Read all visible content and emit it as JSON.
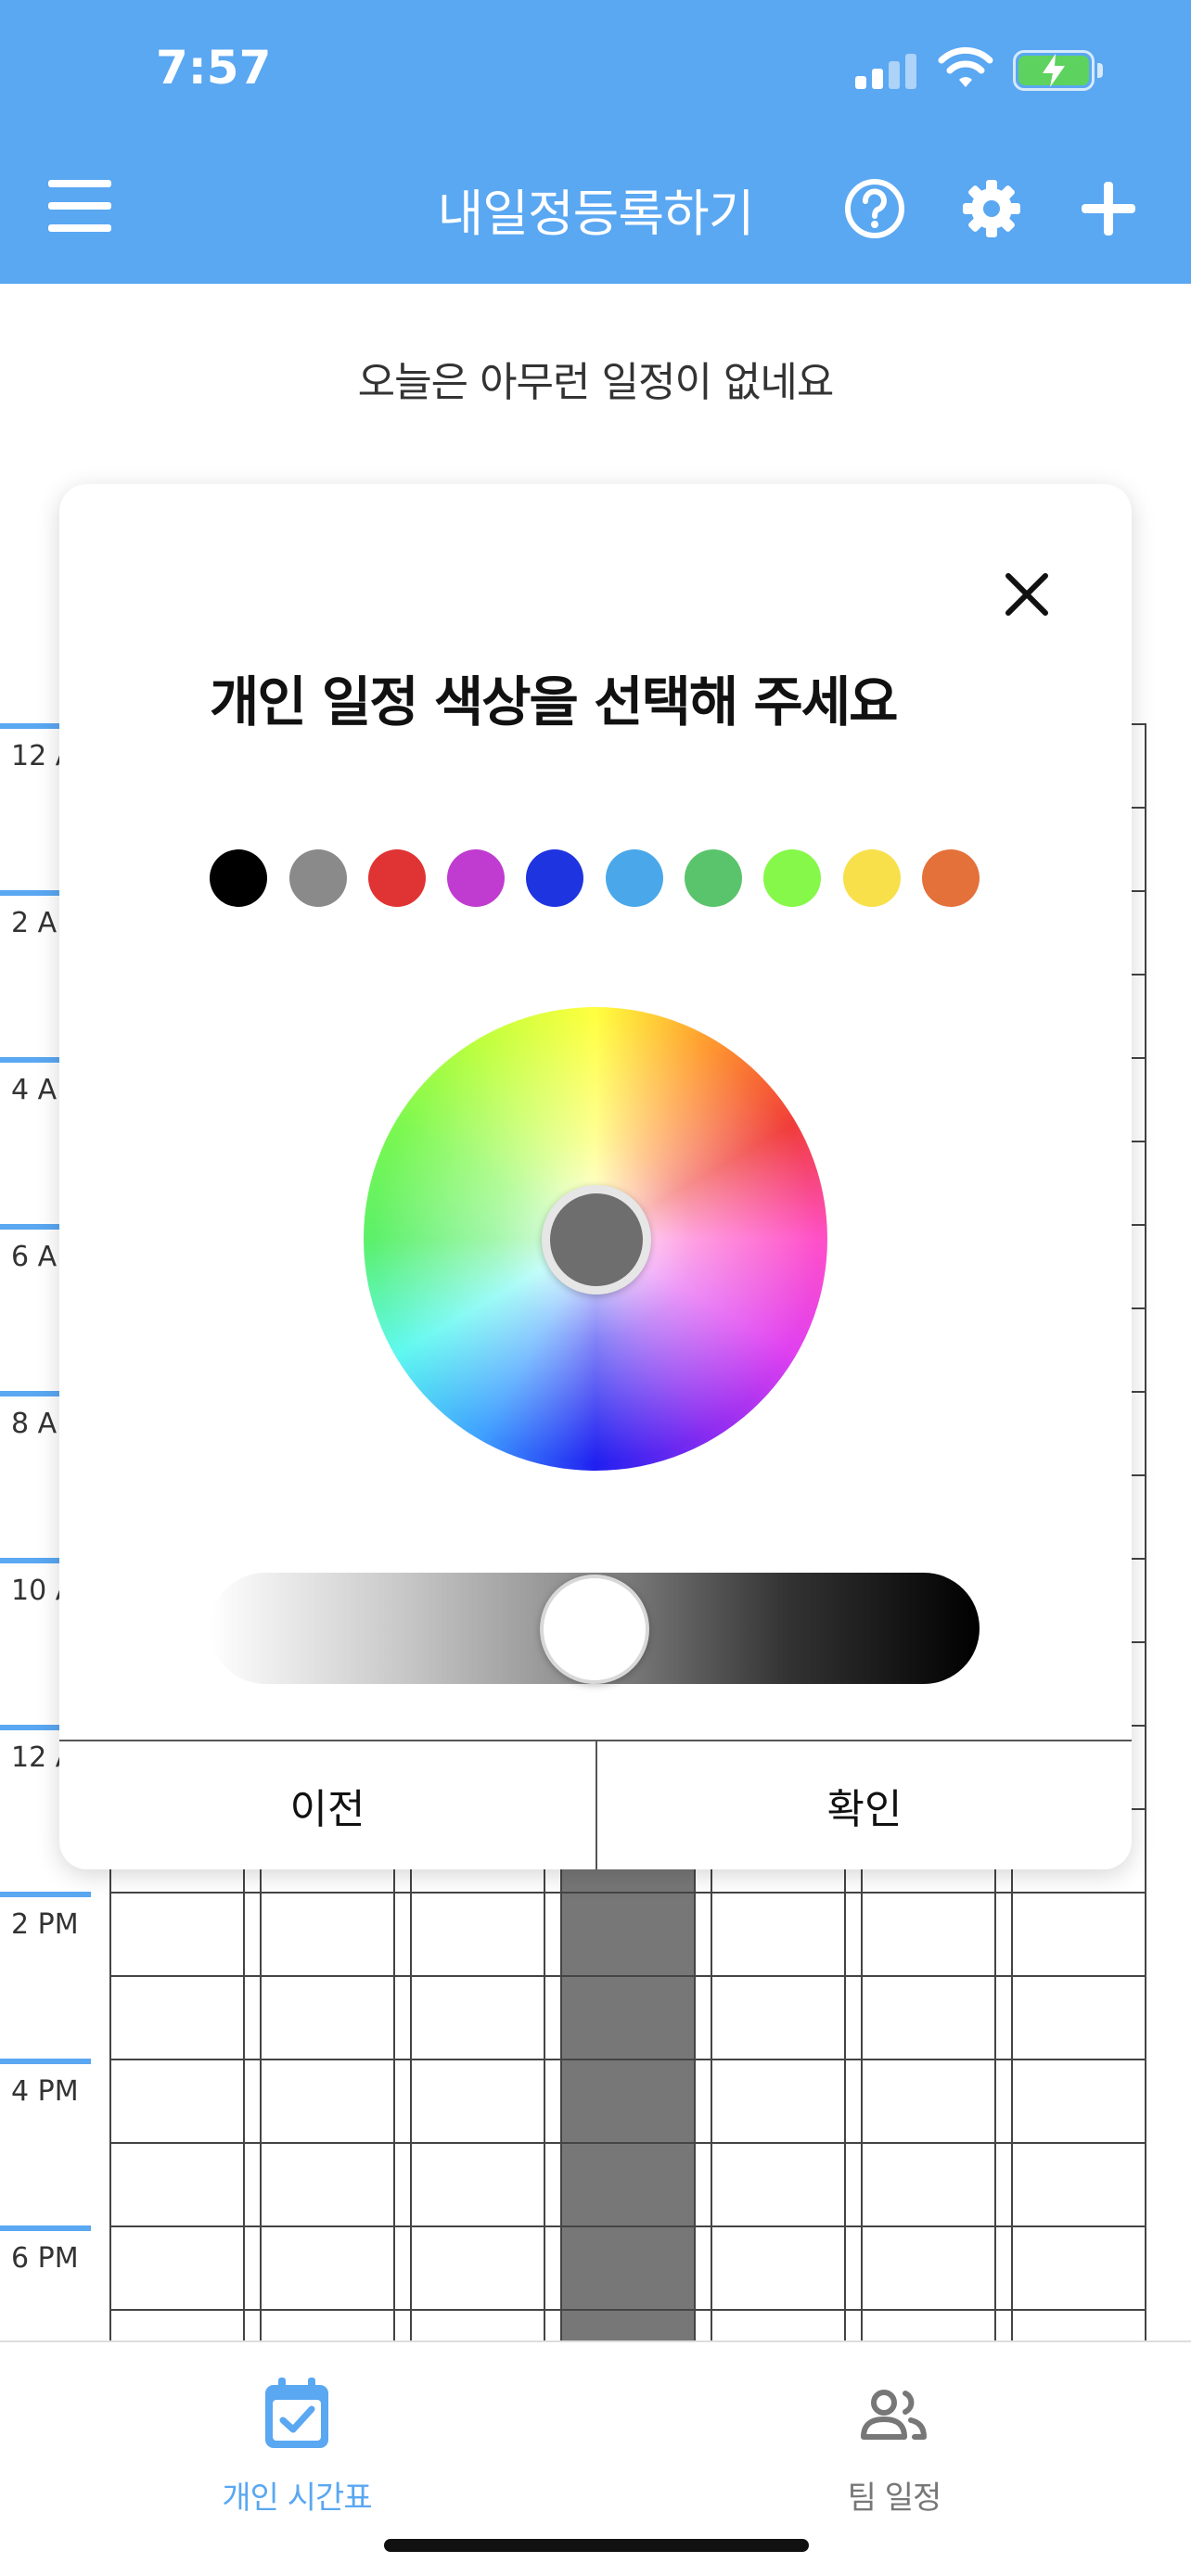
{
  "status_bar": {
    "time": "7:57"
  },
  "header": {
    "title": "내일정등록하기",
    "icons": [
      "menu-icon",
      "help-icon",
      "gear-icon",
      "plus-icon"
    ]
  },
  "empty_message": "오늘은 아무런 일정이 없네요",
  "timetable": {
    "time_labels": [
      "12 A",
      "2 A",
      "4 A",
      "6 A",
      "8 A",
      "10 A",
      "12 A",
      "2 PM",
      "4 PM",
      "6 PM"
    ],
    "accent_color": "#5aa7f2",
    "highlight_color": "#777777"
  },
  "color_modal": {
    "title": "개인 일정 색상을 선택해 주세요",
    "swatches": [
      "#000000",
      "#8a8a8a",
      "#e03434",
      "#c03cd0",
      "#1e34e0",
      "#4aa8ea",
      "#5ac46c",
      "#86f84a",
      "#f8e04a",
      "#e4703a"
    ],
    "selected_color": "#6e6e6e",
    "brightness": 0.5,
    "prev_label": "이전",
    "confirm_label": "확인"
  },
  "bottom_nav": {
    "tabs": [
      {
        "label": "개인 시간표",
        "icon": "calendar-check-icon",
        "active": true,
        "color": "#5aa7f2"
      },
      {
        "label": "팀 일정",
        "icon": "people-icon",
        "active": false,
        "color": "#777777"
      }
    ]
  }
}
